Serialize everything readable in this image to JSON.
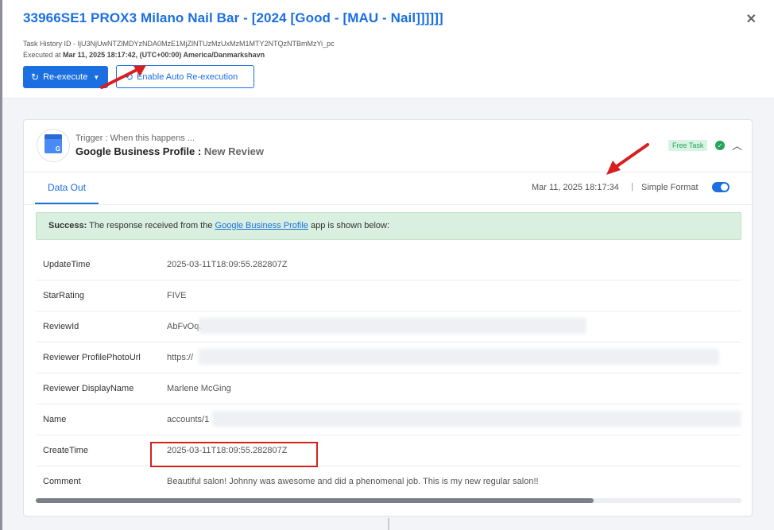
{
  "header": {
    "title": "33966SE1 PROX3 Milano Nail Bar - [2024 [Good - [MAU - Nail]]]]]]",
    "task_history_label": "Task History ID - ",
    "task_history_id": "IjU3NjUwNTZlMDYzNDA0MzE1MjZlNTUzMzUxMzM1MTY2NTQzNTBmMzYi_pc",
    "executed_label": "Executed at ",
    "executed_value": "Mar 11, 2025 18:17:42, (UTC+00:00) America/Danmarkshavn",
    "reexecute_label": "Re-execute",
    "auto_reexecute_label": "Enable Auto Re-execution",
    "close_glyph": "✕"
  },
  "trigger": {
    "label": "Trigger : When this happens ...",
    "app_name": "Google Business Profile : ",
    "event": "New Review",
    "badge": "Free Task"
  },
  "tabs": {
    "data_out": "Data Out"
  },
  "toolbar": {
    "timestamp": "Mar 11, 2025 18:17:34",
    "separator": "|",
    "simple_format_label": "Simple Format",
    "simple_format_on": true
  },
  "success": {
    "prefix": "Success:",
    "text_before": " The response received from the ",
    "link": "Google Business Profile",
    "text_after": " app is shown below:"
  },
  "rows": [
    {
      "key": "UpdateTime",
      "value": "2025-03-11T18:09:55.282807Z"
    },
    {
      "key": "StarRating",
      "value": "FIVE"
    },
    {
      "key": "ReviewId",
      "value": "AbFvOqJ"
    },
    {
      "key": "Reviewer ProfilePhotoUrl",
      "value": "https://"
    },
    {
      "key": "Reviewer DisplayName",
      "value": "Marlene McGing"
    },
    {
      "key": "Name",
      "value": "accounts/1"
    },
    {
      "key": "CreateTime",
      "value": "2025-03-11T18:09:55.282807Z"
    },
    {
      "key": "Comment",
      "value": "Beautiful salon! Johnny was awesome and did a phenomenal job. This is my new regular salon!!"
    }
  ],
  "colors": {
    "accent": "#1b6fe0",
    "success_bg": "#d9efdf",
    "badge_green": "#27a35a",
    "annotation_red": "#d62020"
  },
  "horizontal_scroll_position": 0.79
}
